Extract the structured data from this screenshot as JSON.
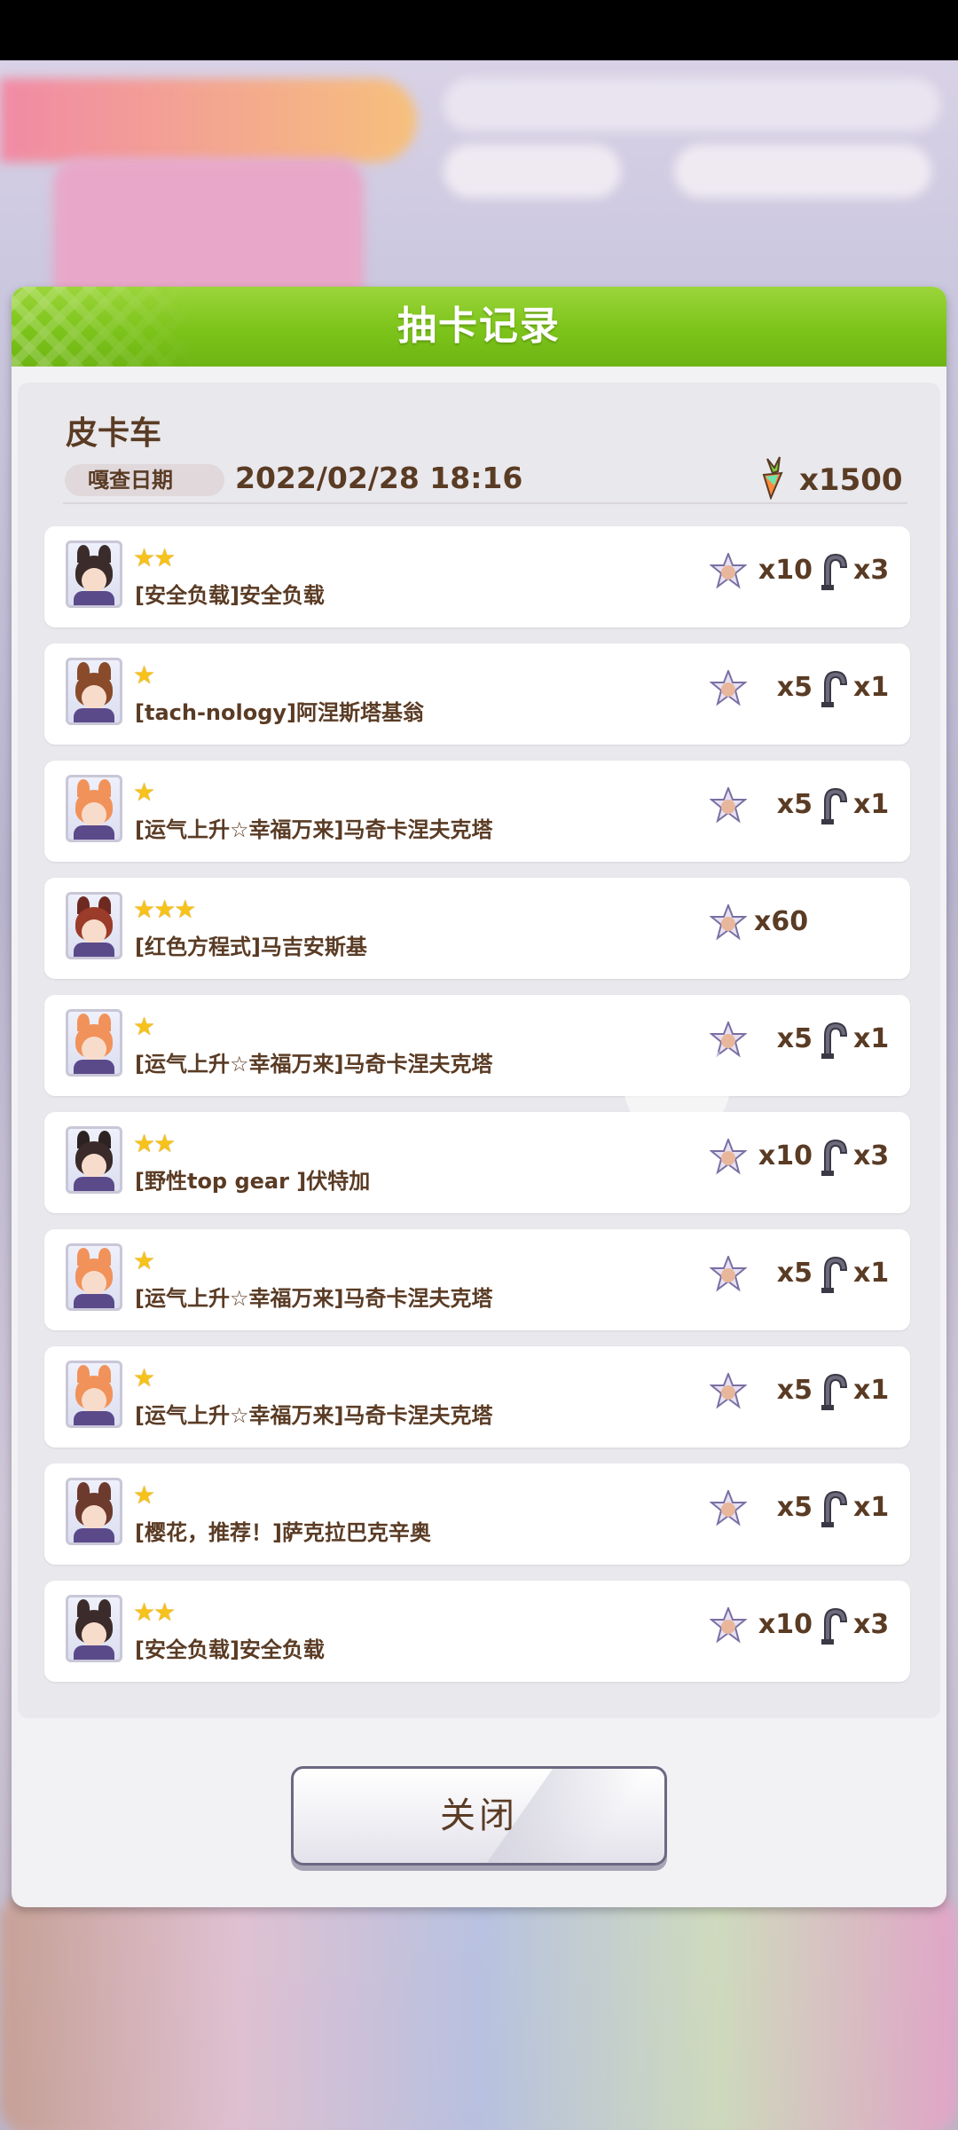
{
  "dialog": {
    "title": "抽卡记录",
    "pool_name": "皮卡车",
    "date_label": "嘎查日期",
    "date_value": "2022/02/28 18:16",
    "total_cost": "x1500",
    "close_label": "关闭"
  },
  "records": [
    {
      "stars": "★★",
      "name": "[安全负载]安全负载",
      "pieces": "x10",
      "shoes": "x3",
      "palette": {
        "hair": "#3b2c2b",
        "ear": "#3b2c2b"
      }
    },
    {
      "stars": "★",
      "name": "[tach-nology]阿涅斯塔基翁",
      "pieces": "x5",
      "shoes": "x1",
      "palette": {
        "hair": "#8a4b2a",
        "ear": "#8a4b2a"
      }
    },
    {
      "stars": "★",
      "name": "[运气上升☆幸福万来]马奇卡涅夫克塔",
      "pieces": "x5",
      "shoes": "x1",
      "palette": {
        "hair": "#f1925a",
        "ear": "#f1925a"
      }
    },
    {
      "stars": "★★★",
      "name": "[红色方程式]马吉安斯基",
      "pieces": "x60",
      "shoes": "",
      "palette": {
        "hair": "#9b3b2a",
        "ear": "#6e2a20"
      }
    },
    {
      "stars": "★",
      "name": "[运气上升☆幸福万来]马奇卡涅夫克塔",
      "pieces": "x5",
      "shoes": "x1",
      "palette": {
        "hair": "#f1925a",
        "ear": "#f1925a"
      }
    },
    {
      "stars": "★★",
      "name": "[野性top gear ]伏特加",
      "pieces": "x10",
      "shoes": "x3",
      "palette": {
        "hair": "#3a2a2a",
        "ear": "#2c2222"
      }
    },
    {
      "stars": "★",
      "name": "[运气上升☆幸福万来]马奇卡涅夫克塔",
      "pieces": "x5",
      "shoes": "x1",
      "palette": {
        "hair": "#f1925a",
        "ear": "#f1925a"
      }
    },
    {
      "stars": "★",
      "name": "[运气上升☆幸福万来]马奇卡涅夫克塔",
      "pieces": "x5",
      "shoes": "x1",
      "palette": {
        "hair": "#f1925a",
        "ear": "#f1925a"
      }
    },
    {
      "stars": "★",
      "name": "[樱花，推荐！]萨克拉巴克辛奥",
      "pieces": "x5",
      "shoes": "x1",
      "palette": {
        "hair": "#6d3a2e",
        "ear": "#6d3a2e"
      }
    },
    {
      "stars": "★★",
      "name": "[安全负载]安全负载",
      "pieces": "x10",
      "shoes": "x3",
      "palette": {
        "hair": "#3b2c2b",
        "ear": "#3b2c2b"
      }
    }
  ],
  "colors": {
    "header_green": "#7cc31a",
    "text_brown": "#5a3b24",
    "star_gold": "#f6c21b"
  },
  "icons": {
    "carrot": "carrot-icon",
    "piece": "support-piece-icon",
    "horseshoe": "horseshoe-icon"
  }
}
